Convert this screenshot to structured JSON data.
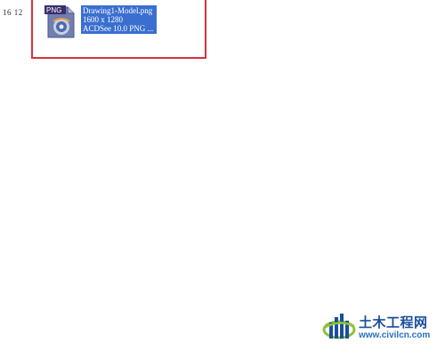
{
  "side_label": "16 12",
  "file": {
    "badge": "PNG",
    "name": "Drawing1-Model.png",
    "dimensions": "1600 x 1280",
    "type": "ACDSee 10.0 PNG ..."
  },
  "watermark": {
    "title": "土木工程网",
    "url": "www.civilcn.com"
  },
  "colors": {
    "highlight_border": "#d9303a",
    "selection": "#3a6fd0",
    "watermark_blue": "#1a4f9c"
  }
}
